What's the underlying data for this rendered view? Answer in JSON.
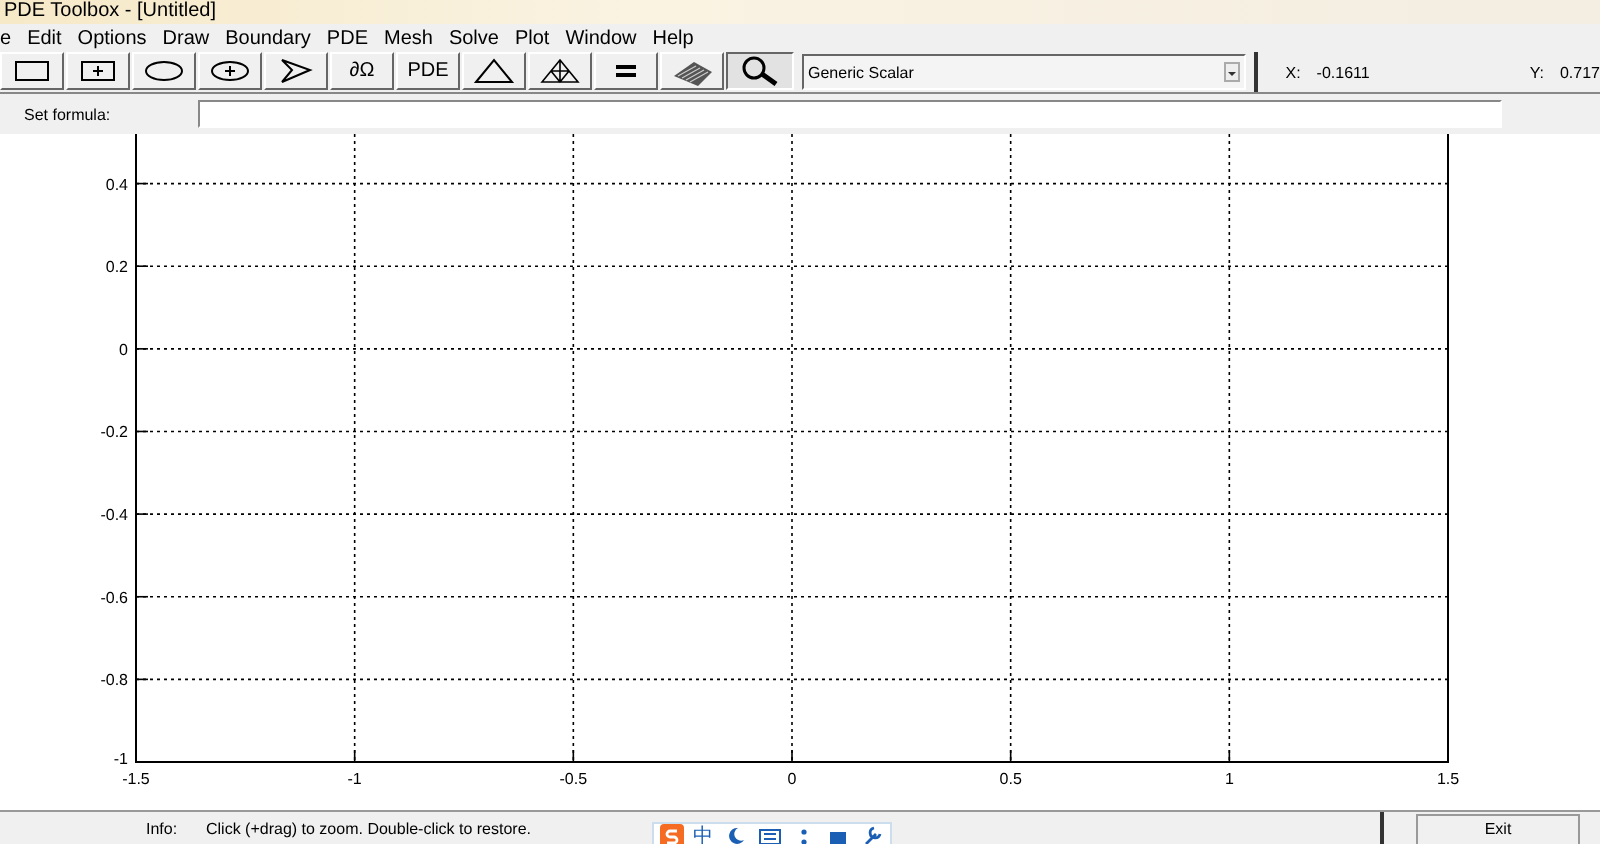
{
  "window": {
    "title": "PDE Toolbox - [Untitled]"
  },
  "menu": [
    "e",
    "Edit",
    "Options",
    "Draw",
    "Boundary",
    "PDE",
    "Mesh",
    "Solve",
    "Plot",
    "Window",
    "Help"
  ],
  "toolbar": [
    {
      "kind": "rectangle",
      "selected": false
    },
    {
      "kind": "rectangle-center",
      "selected": false
    },
    {
      "kind": "ellipse",
      "selected": false
    },
    {
      "kind": "ellipse-center",
      "selected": false
    },
    {
      "kind": "polygon",
      "selected": false
    },
    {
      "kind": "text",
      "label": "∂Ω",
      "selected": false
    },
    {
      "kind": "text",
      "label": "PDE",
      "selected": false
    },
    {
      "kind": "triangle",
      "selected": false
    },
    {
      "kind": "refine",
      "selected": false
    },
    {
      "kind": "equals",
      "selected": false
    },
    {
      "kind": "surface",
      "selected": false
    },
    {
      "kind": "zoom",
      "selected": true
    }
  ],
  "app_mode": {
    "value": "Generic Scalar"
  },
  "coordinates": {
    "x_label": "X:",
    "x_value": "-0.1611",
    "y_label": "Y:",
    "y_value": "0.717"
  },
  "formula": {
    "label": "Set formula:"
  },
  "plot": {
    "chart_data": {
      "type": "line",
      "grid": true,
      "xlim": [
        -1.5,
        1.5
      ],
      "ylim": [
        -1,
        0.52
      ],
      "xticks": [
        -1.5,
        -1,
        -0.5,
        0,
        0.5,
        1,
        1.5
      ],
      "yticks": [
        -1,
        -0.8,
        -0.6,
        -0.4,
        -0.2,
        0,
        0.2,
        0.4
      ]
    }
  },
  "status": {
    "label": "Info:",
    "message": "Click (+drag) to zoom. Double-click to restore.",
    "exit": "Exit"
  },
  "ime_bar": {
    "mode": "中"
  }
}
